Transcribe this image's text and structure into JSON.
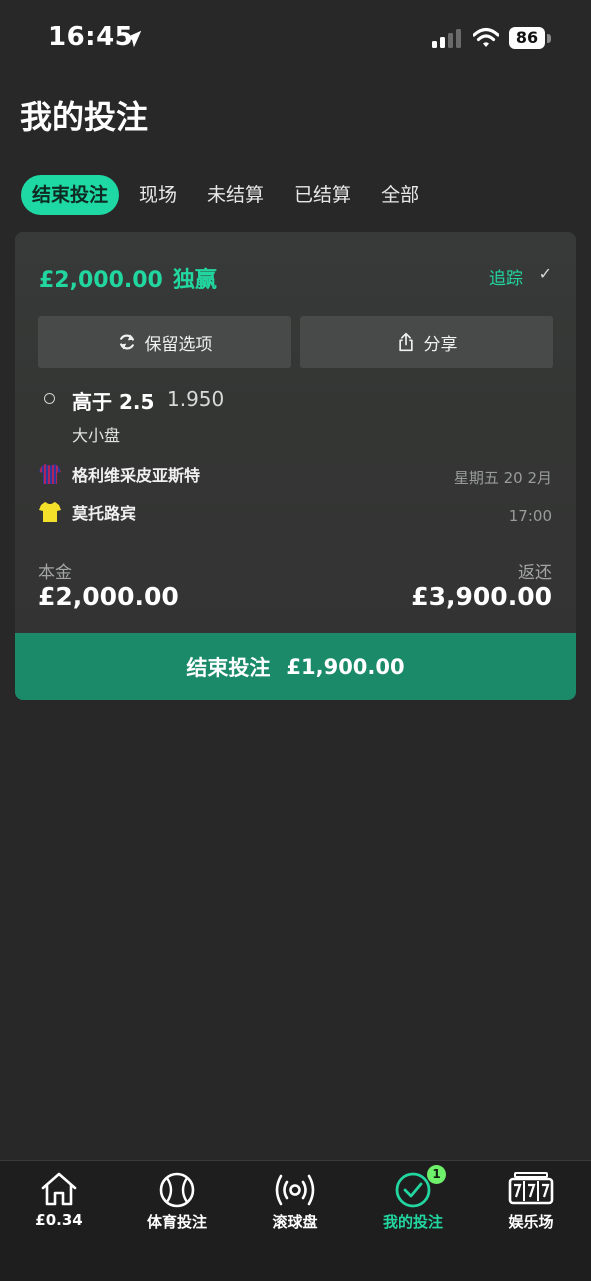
{
  "status_bar": {
    "time": "16:45",
    "battery": "86"
  },
  "page_title": "我的投注",
  "tabs": [
    {
      "label": "结束投注",
      "active": true
    },
    {
      "label": "现场",
      "active": false
    },
    {
      "label": "未结算",
      "active": false
    },
    {
      "label": "已结算",
      "active": false
    },
    {
      "label": "全部",
      "active": false
    }
  ],
  "bet": {
    "stake_amount": "£2,000.00",
    "bet_type": "独赢",
    "track_label": "追踪",
    "track_check": "✓",
    "keep_selections_label": "保留选项",
    "share_label": "分享",
    "selection": "高于 2.5",
    "odds": "1.950",
    "market": "大小盘",
    "home_team": "格利维采皮亚斯特",
    "away_team": "莫托路宾",
    "date": "星期五 20 2月",
    "kickoff": "17:00",
    "stake_label": "本金",
    "stake_value": "£2,000.00",
    "return_label": "返还",
    "return_value": "£3,900.00",
    "cashout_label": "结束投注",
    "cashout_amount": "£1,900.00"
  },
  "bottom_nav": [
    {
      "label": "£0.34",
      "icon": "home-icon"
    },
    {
      "label": "体育投注",
      "icon": "sports-ball-icon"
    },
    {
      "label": "滚球盘",
      "icon": "live-broadcast-icon"
    },
    {
      "label": "我的投注",
      "icon": "check-circle-icon",
      "active": true,
      "badge": "1"
    },
    {
      "label": "娱乐场",
      "icon": "slot-machine-icon"
    }
  ],
  "colors": {
    "accent": "#22d6a0",
    "cashout": "#1a8a68",
    "background": "#282828"
  }
}
